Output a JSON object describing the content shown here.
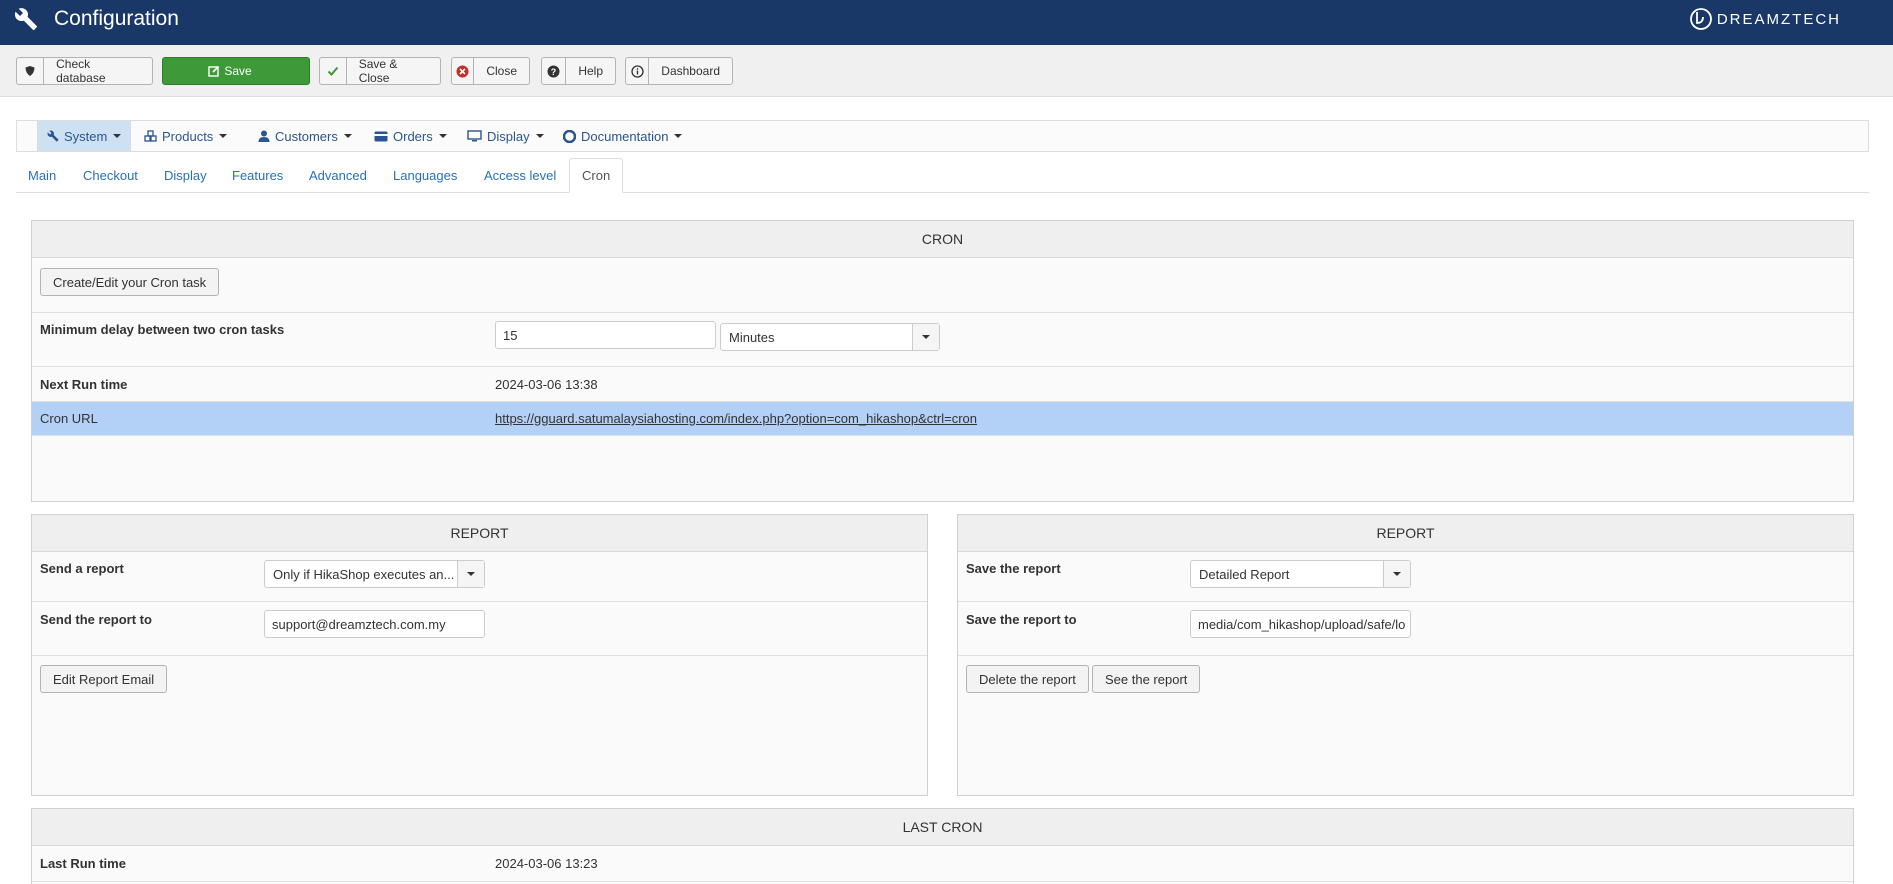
{
  "header": {
    "title": "Configuration",
    "brand": "DREAMZTECH"
  },
  "toolbar": {
    "check_database": "Check database",
    "save": "Save",
    "save_close": "Save & Close",
    "close": "Close",
    "help": "Help",
    "dashboard": "Dashboard"
  },
  "menu": {
    "system": "System",
    "products": "Products",
    "customers": "Customers",
    "orders": "Orders",
    "display": "Display",
    "documentation": "Documentation"
  },
  "tabs": {
    "main": "Main",
    "checkout": "Checkout",
    "display": "Display",
    "features": "Features",
    "advanced": "Advanced",
    "languages": "Languages",
    "access_level": "Access level",
    "cron": "Cron"
  },
  "cron": {
    "heading": "CRON",
    "create_button": "Create/Edit your Cron task",
    "min_delay_label": "Minimum delay between two cron tasks",
    "min_delay_value": "15",
    "min_delay_unit": "Minutes",
    "next_run_label": "Next Run time",
    "next_run_value": "2024-03-06 13:38",
    "url_label": "Cron URL",
    "url_value": "https://gguard.satumalaysiahosting.com/index.php?option=com_hikashop&ctrl=cron"
  },
  "report_send": {
    "heading": "REPORT",
    "send_label": "Send a report",
    "send_value": "Only if HikaShop executes an...",
    "send_to_label": "Send the report to",
    "send_to_value": "support@dreamztech.com.my",
    "edit_button": "Edit Report Email"
  },
  "report_save": {
    "heading": "REPORT",
    "save_label": "Save the report",
    "save_value": "Detailed Report",
    "save_to_label": "Save the report to",
    "save_to_value": "media/com_hikashop/upload/safe/lo",
    "delete_button": "Delete the report",
    "see_button": "See the report"
  },
  "last_cron": {
    "heading": "LAST CRON",
    "last_run_label": "Last Run time",
    "last_run_value": "2024-03-06 13:23"
  },
  "colors": {
    "header_bg": "#1a3867",
    "save_green": "#3e9a38",
    "highlight_row": "#b3d0f7",
    "link": "#1a3e8a"
  }
}
